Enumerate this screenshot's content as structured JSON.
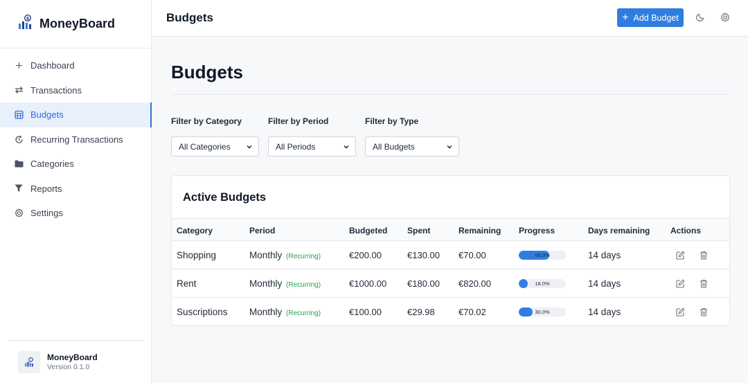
{
  "app": {
    "name": "MoneyBoard",
    "version": "Version 0.1.0"
  },
  "sidebar": {
    "items": [
      {
        "label": "Dashboard",
        "icon": "plus-icon"
      },
      {
        "label": "Transactions",
        "icon": "arrows-exchange-icon"
      },
      {
        "label": "Budgets",
        "icon": "calendar-grid-icon",
        "active": true
      },
      {
        "label": "Recurring Transactions",
        "icon": "recurring-icon"
      },
      {
        "label": "Categories",
        "icon": "folder-icon"
      },
      {
        "label": "Reports",
        "icon": "filter-funnel-icon"
      },
      {
        "label": "Settings",
        "icon": "gear-icon"
      }
    ]
  },
  "topbar": {
    "title": "Budgets",
    "add_button": "Add Budget"
  },
  "page": {
    "heading": "Budgets"
  },
  "filters": [
    {
      "label": "Filter by Category",
      "value": "All Categories"
    },
    {
      "label": "Filter by Period",
      "value": "All Periods"
    },
    {
      "label": "Filter by Type",
      "value": "All Budgets"
    }
  ],
  "table": {
    "title": "Active Budgets",
    "columns": [
      "Category",
      "Period",
      "Budgeted",
      "Spent",
      "Remaining",
      "Progress",
      "Days remaining",
      "Actions"
    ],
    "rows": [
      {
        "category": "Shopping",
        "period": "Monthly",
        "tag": "(Recurring)",
        "budgeted": "€200.00",
        "spent": "€130.00",
        "remaining": "€70.00",
        "progress": 65.0,
        "progress_label": "65.0%",
        "days": "14 days"
      },
      {
        "category": "Rent",
        "period": "Monthly",
        "tag": "(Recurring)",
        "budgeted": "€1000.00",
        "spent": "€180.00",
        "remaining": "€820.00",
        "progress": 18.0,
        "progress_label": "18.0%",
        "days": "14 days"
      },
      {
        "category": "Suscriptions",
        "period": "Monthly",
        "tag": "(Recurring)",
        "budgeted": "€100.00",
        "spent": "€29.98",
        "remaining": "€70.02",
        "progress": 30.0,
        "progress_label": "30.0%",
        "days": "14 days"
      }
    ]
  },
  "colors": {
    "accent": "#2f7de1",
    "recurring": "#22a34a",
    "active_bg": "#e8f0fc"
  }
}
